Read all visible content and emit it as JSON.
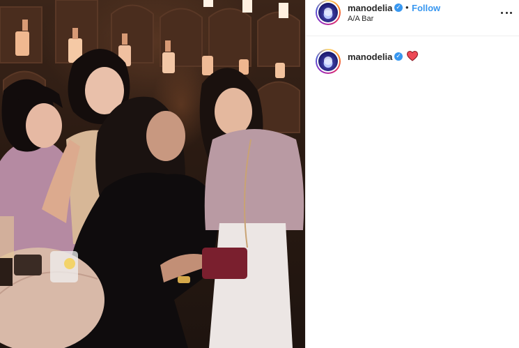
{
  "post": {
    "username": "manodelia",
    "separator": "•",
    "follow_label": "Follow",
    "location": "A/A Bar",
    "more_icon": "more-options-icon",
    "verified_icon": "verified-badge-icon"
  },
  "comment": {
    "username": "manodelia",
    "verified_icon": "verified-badge-icon",
    "emoji": "red-heart-icon"
  },
  "colors": {
    "link_blue": "#3897f0",
    "text": "#262626",
    "heart_red": "#ed4956",
    "divider": "#efefef"
  },
  "photo": {
    "description_icon": "group-photo"
  }
}
